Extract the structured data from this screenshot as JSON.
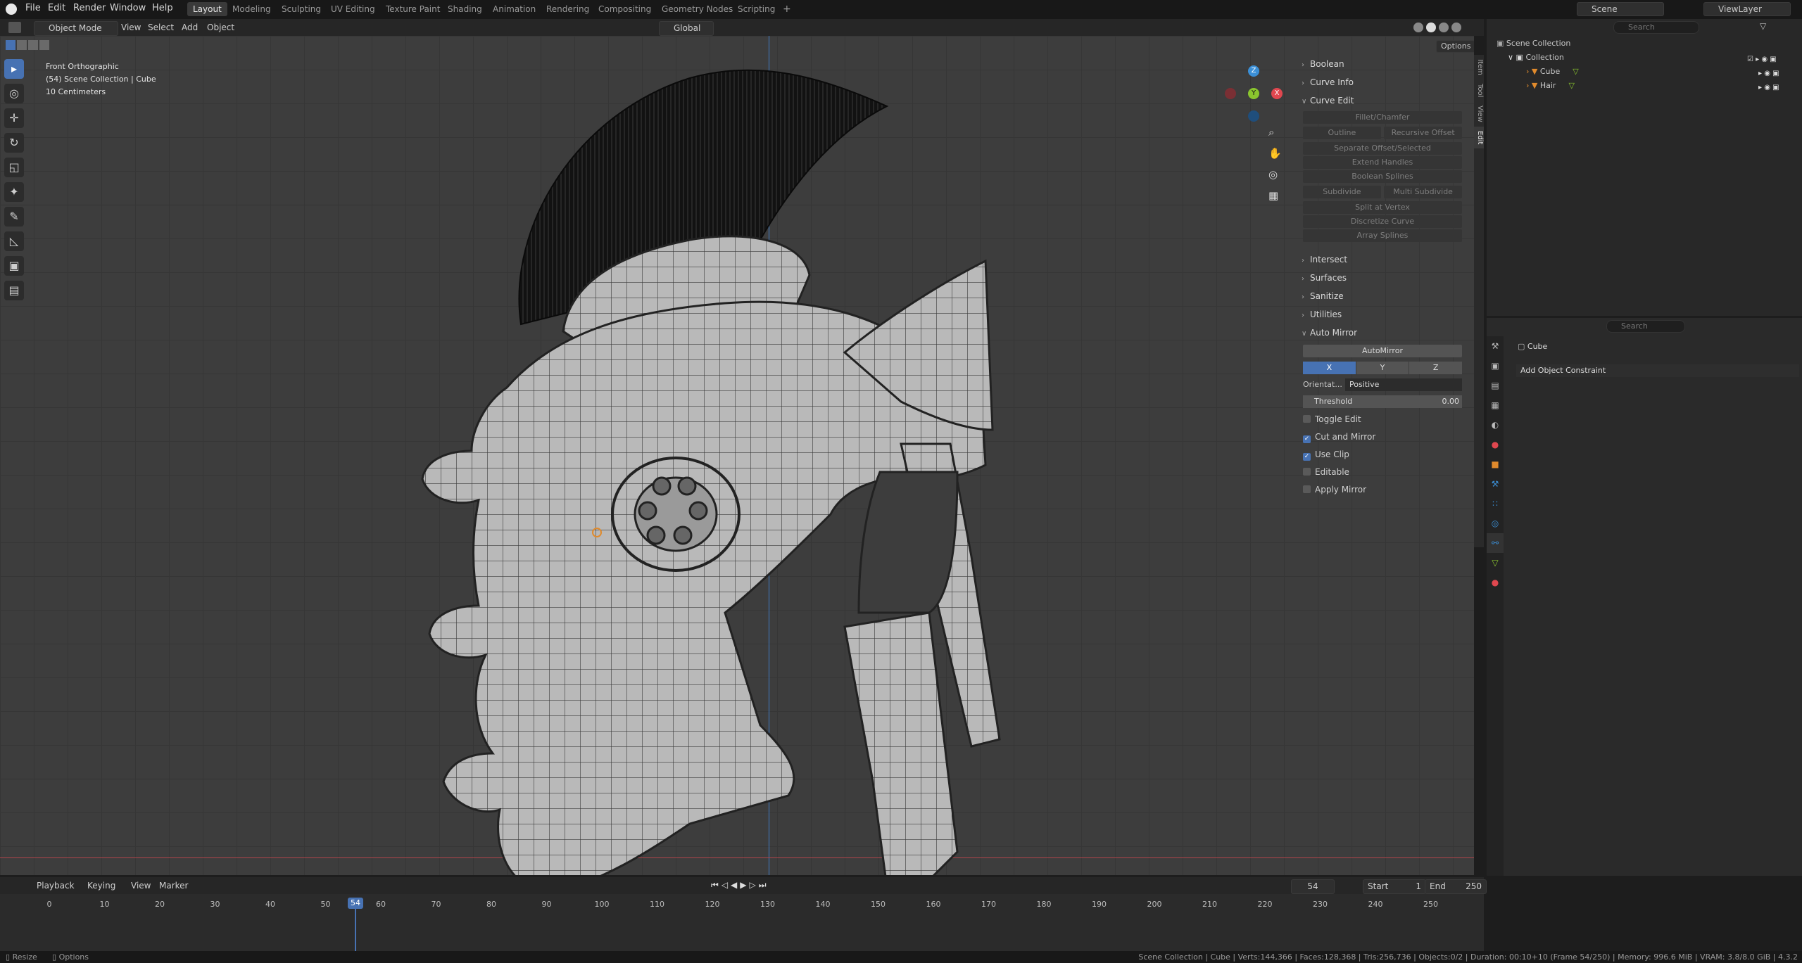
{
  "menu": [
    "File",
    "Edit",
    "Render",
    "Window",
    "Help"
  ],
  "workspaces": [
    "Layout",
    "Modeling",
    "Sculpting",
    "UV Editing",
    "Texture Paint",
    "Shading",
    "Animation",
    "Rendering",
    "Compositing",
    "Geometry Nodes",
    "Scripting"
  ],
  "workspace_add": "+",
  "scene": {
    "name": "Scene",
    "view_layer": "ViewLayer"
  },
  "viewport_header": {
    "mode": "Object Mode",
    "menus": [
      "View",
      "Select",
      "Add",
      "Object"
    ],
    "transform_orientation": "Global",
    "options_label": "Options"
  },
  "viewport_info": {
    "view_name": "Front Orthographic",
    "collection_line": "(54) Scene Collection | Cube",
    "scale": "10 Centimeters"
  },
  "gizmo": {
    "z": "Z",
    "y": "Y",
    "x": "X"
  },
  "npanel": {
    "sections_top": [
      "Boolean",
      "Curve Info"
    ],
    "curve_edit": {
      "title": "Curve Edit",
      "fillet": "Fillet/Chamfer",
      "outline": "Outline",
      "recursive_offset": "Recursive Offset",
      "separate": "Separate Offset/Selected",
      "extend": "Extend Handles",
      "boolean_splines": "Boolean Splines",
      "subdivide": "Subdivide",
      "multi_subdivide": "Multi Subdivide",
      "split": "Split at Vertex",
      "discretize": "Discretize Curve",
      "array": "Array Splines"
    },
    "sections_mid": [
      "Intersect",
      "Surfaces",
      "Sanitize",
      "Utilities"
    ],
    "auto_mirror": {
      "title": "Auto Mirror",
      "button": "AutoMirror",
      "axes": [
        "X",
        "Y",
        "Z"
      ],
      "orientation_label": "Orientat...",
      "orientation_value": "Positive",
      "threshold_label": "Threshold",
      "threshold_value": "0.00",
      "checks": [
        {
          "label": "Toggle Edit",
          "on": false
        },
        {
          "label": "Cut and Mirror",
          "on": true
        },
        {
          "label": "Use Clip",
          "on": true
        },
        {
          "label": "Editable",
          "on": false
        },
        {
          "label": "Apply Mirror",
          "on": false
        }
      ]
    },
    "side_tabs": [
      "Item",
      "Tool",
      "View",
      "Edit"
    ]
  },
  "outliner": {
    "search_placeholder": "Search",
    "root": "Scene Collection",
    "collection": "Collection",
    "objects": [
      "Cube",
      "Hair"
    ]
  },
  "properties": {
    "search_placeholder": "Search",
    "object_name": "Cube",
    "add_constraint": "Add Object Constraint"
  },
  "timeline": {
    "menus": [
      "Playback",
      "Keying",
      "View",
      "Marker"
    ],
    "current_frame": "54",
    "start_label": "Start",
    "start": "1",
    "end_label": "End",
    "end": "250",
    "ticks": [
      "0",
      "10",
      "20",
      "30",
      "40",
      "50",
      "54",
      "60",
      "70",
      "80",
      "90",
      "100",
      "110",
      "120",
      "130",
      "140",
      "150",
      "160",
      "170",
      "180",
      "190",
      "200",
      "210",
      "220",
      "230",
      "240",
      "250"
    ]
  },
  "statusbar": {
    "left1": "Resize",
    "left2": "Options",
    "right": "Scene Collection | Cube | Verts:144,366 | Faces:128,368 | Tris:256,736 | Objects:0/2 | Duration: 00:10+10 (Frame 54/250) | Memory: 996.6 MiB | VRAM: 3.8/8.0 GiB | 4.3.2"
  },
  "colors": {
    "accent": "#4772b3",
    "x_axis": "#e0474f",
    "y_axis": "#8ac52e",
    "z_axis": "#3b8fd6",
    "orange": "#e08a2c"
  }
}
